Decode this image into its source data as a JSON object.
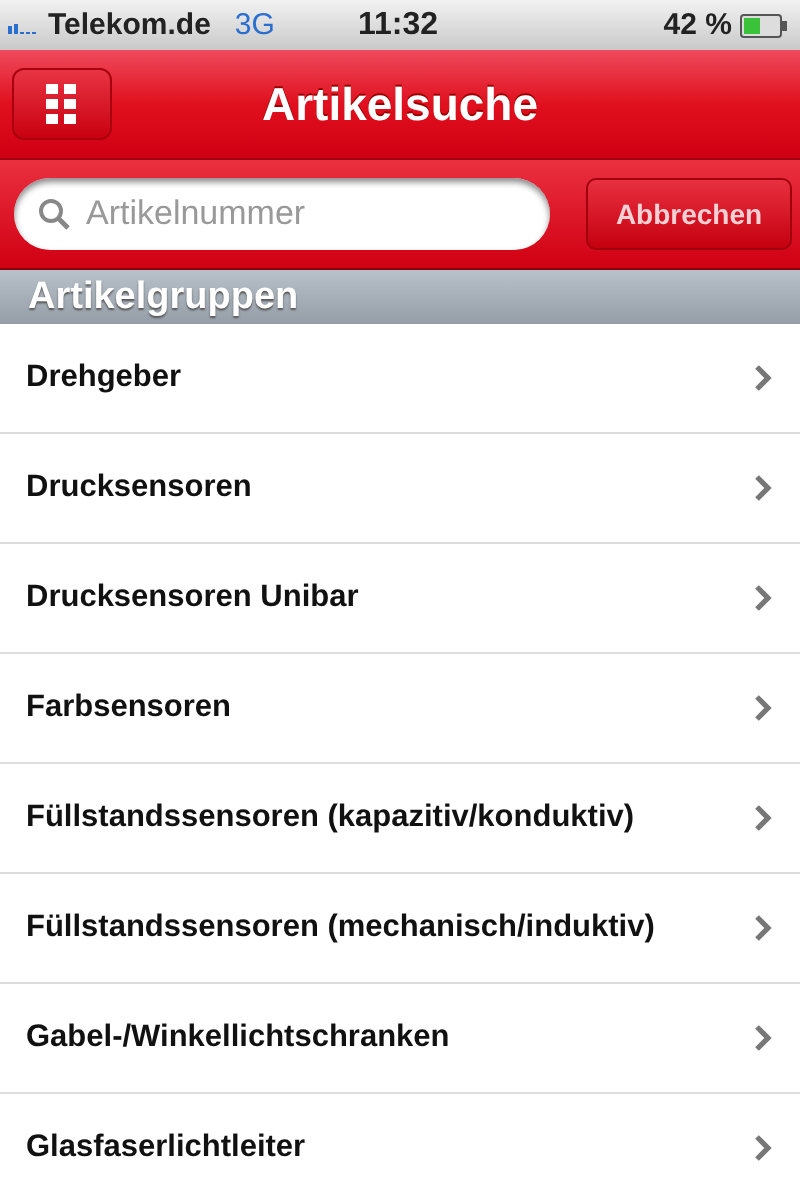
{
  "status_bar": {
    "carrier": "Telekom.de",
    "network": "3G",
    "time": "11:32",
    "battery": "42 %"
  },
  "nav_bar": {
    "title": "Artikelsuche"
  },
  "search": {
    "placeholder": "Artikelnummer",
    "cancel": "Abbrechen"
  },
  "section": {
    "title": "Artikelgruppen"
  },
  "items": [
    {
      "label": "Drehgeber"
    },
    {
      "label": "Drucksensoren"
    },
    {
      "label": "Drucksensoren Unibar"
    },
    {
      "label": "Farbsensoren"
    },
    {
      "label": "Füllstandssensoren (kapazitiv/konduktiv)"
    },
    {
      "label": "Füllstandssensoren (mechanisch/induktiv)"
    },
    {
      "label": "Gabel-/Winkellichtschranken"
    },
    {
      "label": "Glasfaserlichtleiter"
    }
  ]
}
